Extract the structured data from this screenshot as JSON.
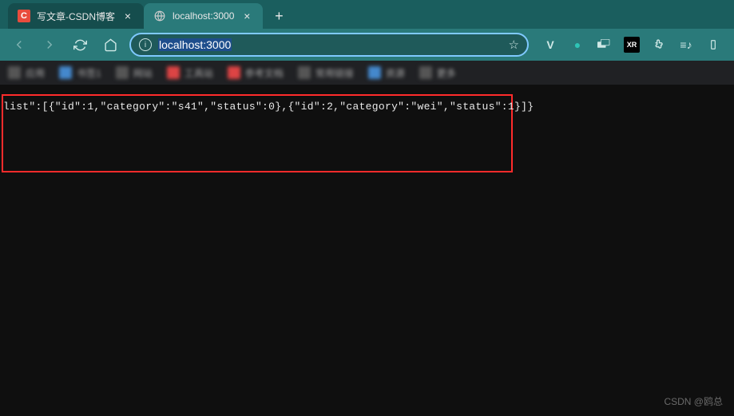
{
  "tabs": [
    {
      "title": "写文章-CSDN博客",
      "favicon": "C",
      "active": false
    },
    {
      "title": "localhost:3000",
      "favicon": "globe",
      "active": true
    }
  ],
  "toolbar": {
    "url": "localhost:3000",
    "new_tab_plus": "+",
    "close_x": "×"
  },
  "extensions": {
    "labels": [
      "V",
      "●",
      "▭",
      "XR",
      "⬚",
      "≡♪",
      "⋮"
    ]
  },
  "bookmarks_blurred": [
    "应用",
    "书签1",
    "网站",
    "工具站",
    "参考文档",
    "常用链接",
    "资源",
    "更多"
  ],
  "page_body": {
    "raw_text": "list\":[{\"id\":1,\"category\":\"s41\",\"status\":0},{\"id\":2,\"category\":\"wei\",\"status\":1}]}"
  },
  "watermark": "CSDN @鸥总"
}
